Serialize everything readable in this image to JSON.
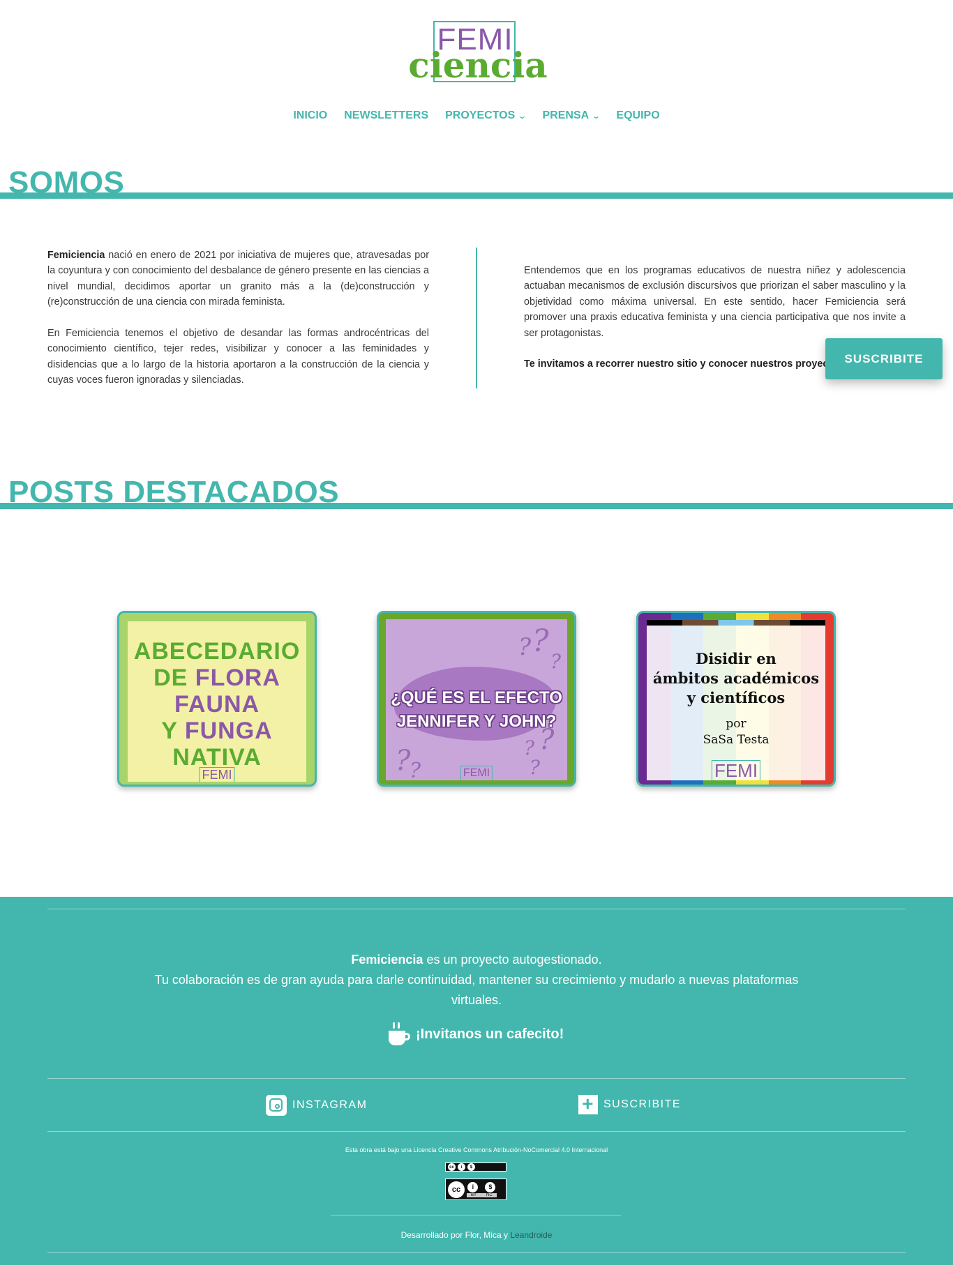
{
  "logo": {
    "line1": "FEMI",
    "line2": "ciencia"
  },
  "nav": {
    "items": [
      {
        "label": "INICIO",
        "dropdown": false
      },
      {
        "label": "NEWSLETTERS",
        "dropdown": false
      },
      {
        "label": "PROYECTOS",
        "dropdown": true
      },
      {
        "label": "PRENSA",
        "dropdown": true
      },
      {
        "label": "EQUIPO",
        "dropdown": false
      }
    ]
  },
  "somos": {
    "title": "SOMOS",
    "left_p1_strong": "Femiciencia",
    "left_p1": " nació en enero de 2021 por iniciativa de mujeres que, atravesadas por la coyuntura y con conocimiento del desbalance de género presente en las ciencias a nivel mundial, decidimos aportar un granito más a la (de)construcción y (re)construcción de una ciencia con mirada feminista.",
    "left_p2": "En Femiciencia tenemos el objetivo de desandar las formas androcéntricas del conocimiento científico, tejer redes, visibilizar y conocer a las feminidades y disidencias que a lo largo de la historia aportaron a la construcción de la ciencia y cuyas voces fueron ignoradas y silenciadas.",
    "right_p1": "Entendemos que en los programas educativos de nuestra niñez y adolescencia actuaban mecanismos de exclusión discursivos que priorizan el saber masculino y la objetividad como máxima universal. En este sentido, hacer Femiciencia será promover una praxis educativa feminista y una ciencia participativa que nos invite a ser protagonistas.",
    "right_p2": "Te invitamos a recorrer nuestro sitio y conocer nuestros proyectos."
  },
  "subscribe_button": "SUSCRIBITE",
  "posts": {
    "title": "POSTS DESTACADOS",
    "post1": {
      "l1": "ABECEDARIO",
      "l2a": "DE ",
      "l2b": "FLORA",
      "l3": "FAUNA",
      "l4a": "Y ",
      "l4b": "FUNGA",
      "l5": "NATIVA",
      "tag": "FEMI"
    },
    "post2": {
      "l1": "¿QUÉ ES EL EFECTO",
      "l2": "JENNIFER Y JOHN?",
      "tag": "FEMI"
    },
    "post3": {
      "l1": "Disidir en",
      "l2": "ámbitos académicos",
      "l3": "y científicos",
      "by1": "por",
      "by2": "SaSa Testa",
      "tag": "FEMI"
    }
  },
  "footer": {
    "brand": "Femiciencia",
    "line1": " es un proyecto autogestionado.",
    "line2": "Tu colaboración es de gran ayuda para darle continuidad, mantener su crecimiento y mudarlo a nuevas plataformas virtuales.",
    "cafe": "¡Invitanos un cafecito!",
    "instagram": "INSTAGRAM",
    "subscribe": "SUSCRIBITE",
    "license": "Esta obra está bajo una Licencia Creative Commons Atribución-NoComercial 4.0 Internacional",
    "badge_by": "BY",
    "badge_nc": "NC",
    "dev_prefix": "Desarrollado por Flor, Mica y ",
    "dev_link": "Leandroide"
  },
  "colors": {
    "teal": "#43b7ad",
    "purple": "#8b58a8",
    "green": "#5aab32"
  }
}
